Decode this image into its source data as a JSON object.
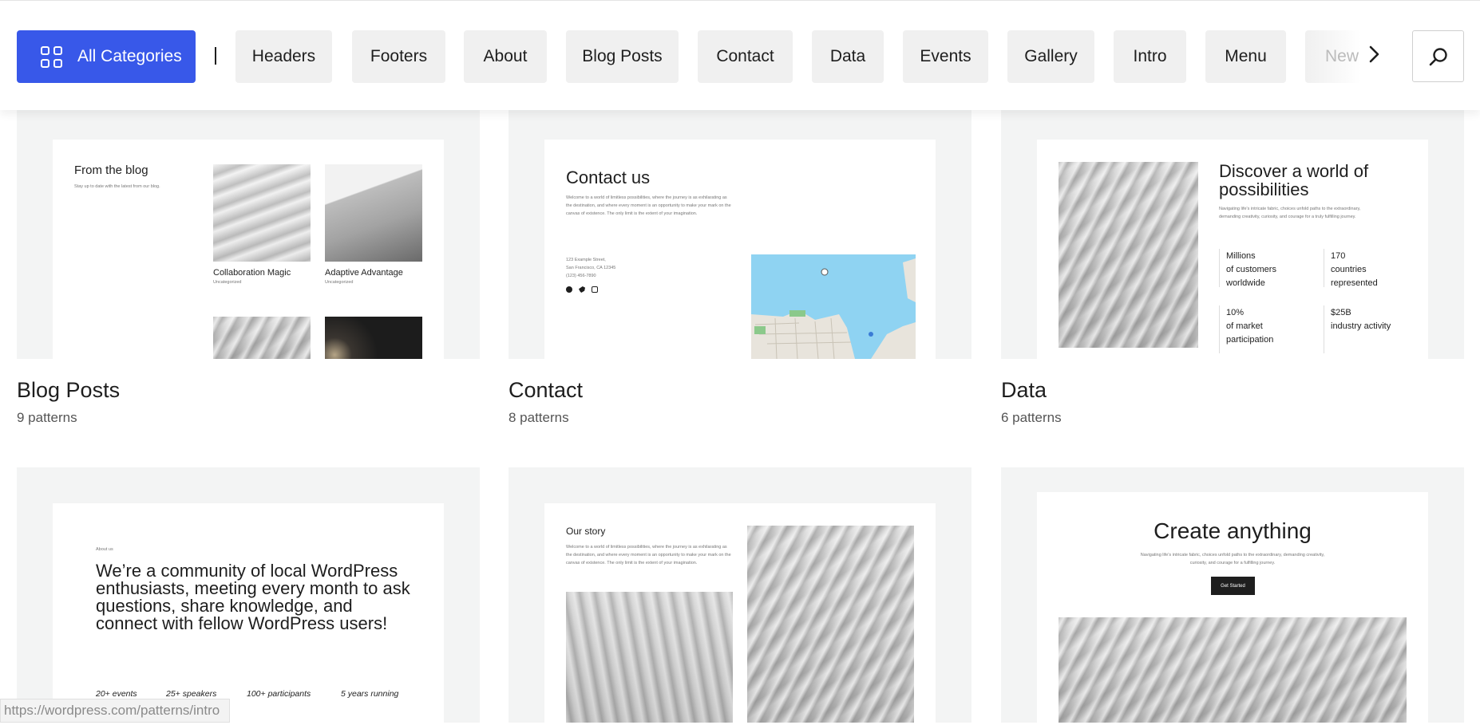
{
  "nav": {
    "all_categories_label": "All Categories",
    "categories": [
      "Headers",
      "Footers",
      "About",
      "Blog Posts",
      "Contact",
      "Data",
      "Events",
      "Gallery",
      "Intro",
      "Menu",
      "New"
    ],
    "accent_color": "#3858e9"
  },
  "cards": [
    {
      "title": "Blog Posts",
      "count": "9 patterns",
      "preview": {
        "heading": "From the blog",
        "subtitle": "Stay up to date with the latest from our blog.",
        "posts": [
          {
            "title": "Collaboration Magic",
            "category": "Uncategorized"
          },
          {
            "title": "Adaptive Advantage",
            "category": "Uncategorized"
          }
        ]
      }
    },
    {
      "title": "Contact",
      "count": "8 patterns",
      "preview": {
        "heading": "Contact us",
        "body": "Welcome to a world of limitless possibilities, where the journey is as exhilarating as the destination, and where every moment is an opportunity to make your mark on the canvas of existence. The only limit is the extent of your imagination.",
        "address": [
          "123 Example Street,",
          "San Francisco, CA 12345",
          "(123) 456-7890"
        ],
        "social_icons": [
          "facebook-icon",
          "twitter-icon",
          "instagram-icon"
        ]
      }
    },
    {
      "title": "Data",
      "count": "6 patterns",
      "preview": {
        "heading": "Discover a world of possibilities",
        "body": "Navigating life's intricate fabric, choices unfold paths to the extraordinary, demanding creativity, curiosity, and courage for a truly fulfilling journey.",
        "stats": [
          {
            "value": "Millions",
            "label": "of customers worldwide"
          },
          {
            "value": "170",
            "label": "countries represented"
          },
          {
            "value": "10%",
            "label": "of market participation"
          },
          {
            "value": "$25B",
            "label": "industry activity"
          }
        ]
      }
    },
    {
      "preview": {
        "eyebrow": "About us",
        "heading": "We’re a community of local WordPress enthusiasts, meeting every month to ask questions, share knowledge, and connect with fellow WordPress users!",
        "facts": [
          "20+ events",
          "25+ speakers",
          "100+ participants",
          "5 years running"
        ]
      }
    },
    {
      "preview": {
        "heading": "Our story",
        "body": "Welcome to a world of limitless possibilities, where the journey is as exhilarating as the destination, and where every moment is an opportunity to make your mark on the canvas of existence. The only limit is the extent of your imagination."
      }
    },
    {
      "preview": {
        "heading": "Create anything",
        "body": "Navigating life's intricate fabric, choices unfold paths to the extraordinary, demanding creativity, curiosity, and courage for a fulfilling journey.",
        "button": "Get Started"
      }
    }
  ],
  "status_bar": {
    "url": "https://wordpress.com/patterns/intro"
  }
}
